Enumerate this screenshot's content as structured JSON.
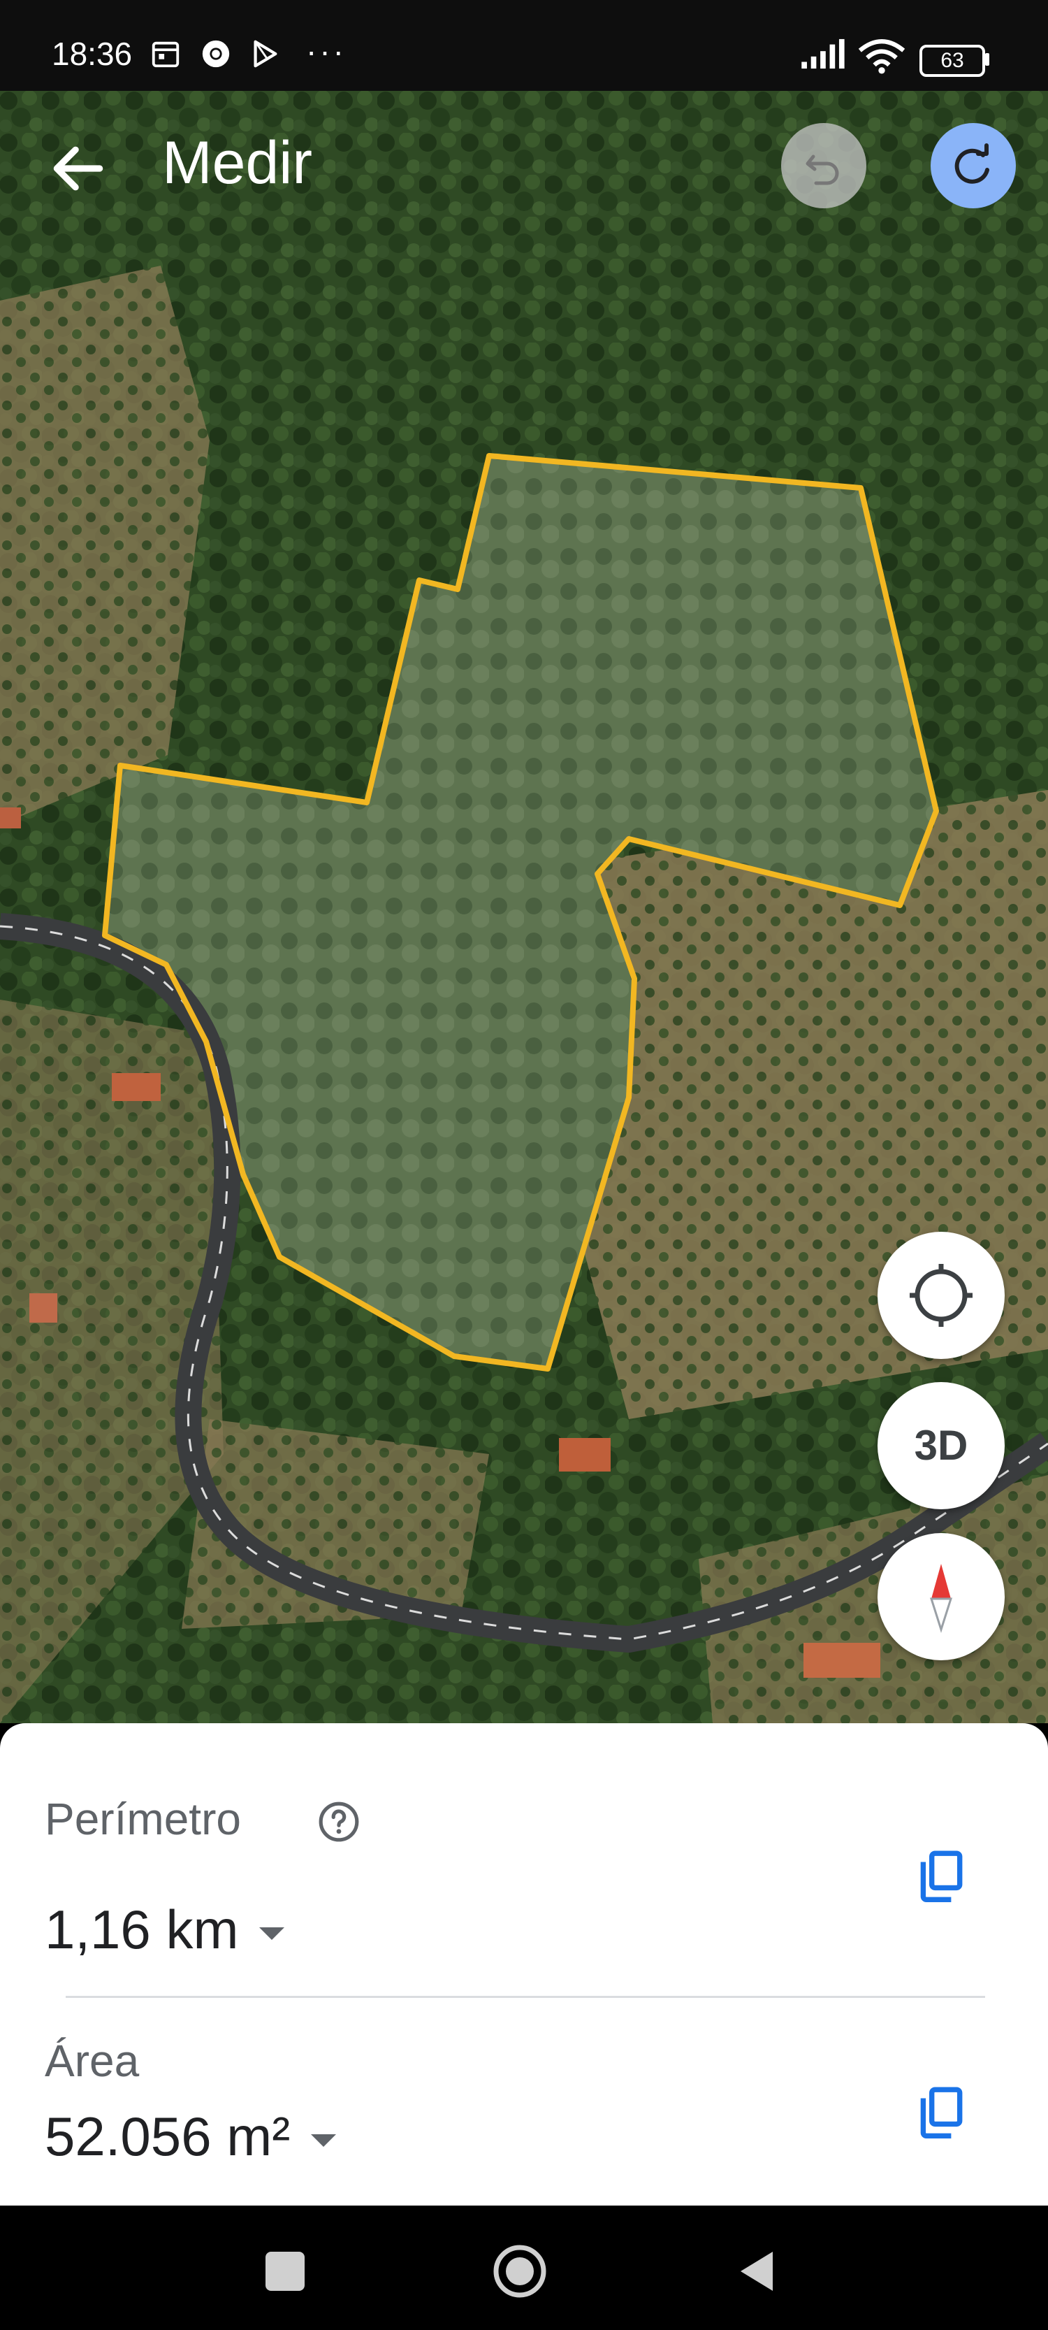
{
  "status_bar": {
    "time": "18:36",
    "icons": [
      "calendar-icon",
      "chrome-icon",
      "play-store-icon",
      "more-dots-icon",
      "signal-icon",
      "wifi-icon"
    ],
    "dots": "···",
    "battery": "63"
  },
  "app_bar": {
    "title": "Medir",
    "back_icon": "arrow-back-icon",
    "undo_icon": "undo-icon",
    "redo_icon": "redo-icon"
  },
  "map_controls": {
    "locate_icon": "my-location-icon",
    "three_d_label": "3D",
    "compass_icon": "compass-icon"
  },
  "measurement": {
    "perimeter_label": "Perímetro",
    "perimeter_value": "1,16 km",
    "area_label": "Área",
    "area_value": "52.056 m²",
    "help_icon": "help-circle-icon",
    "copy_icon": "copy-icon"
  },
  "colors": {
    "polygon_outline": "#f2b722",
    "redo_accent": "#8ab4f8",
    "copy_icon": "#1a73e8"
  },
  "nav_bar": {
    "icons": [
      "recents-square-icon",
      "home-circle-icon",
      "back-triangle-icon"
    ]
  }
}
